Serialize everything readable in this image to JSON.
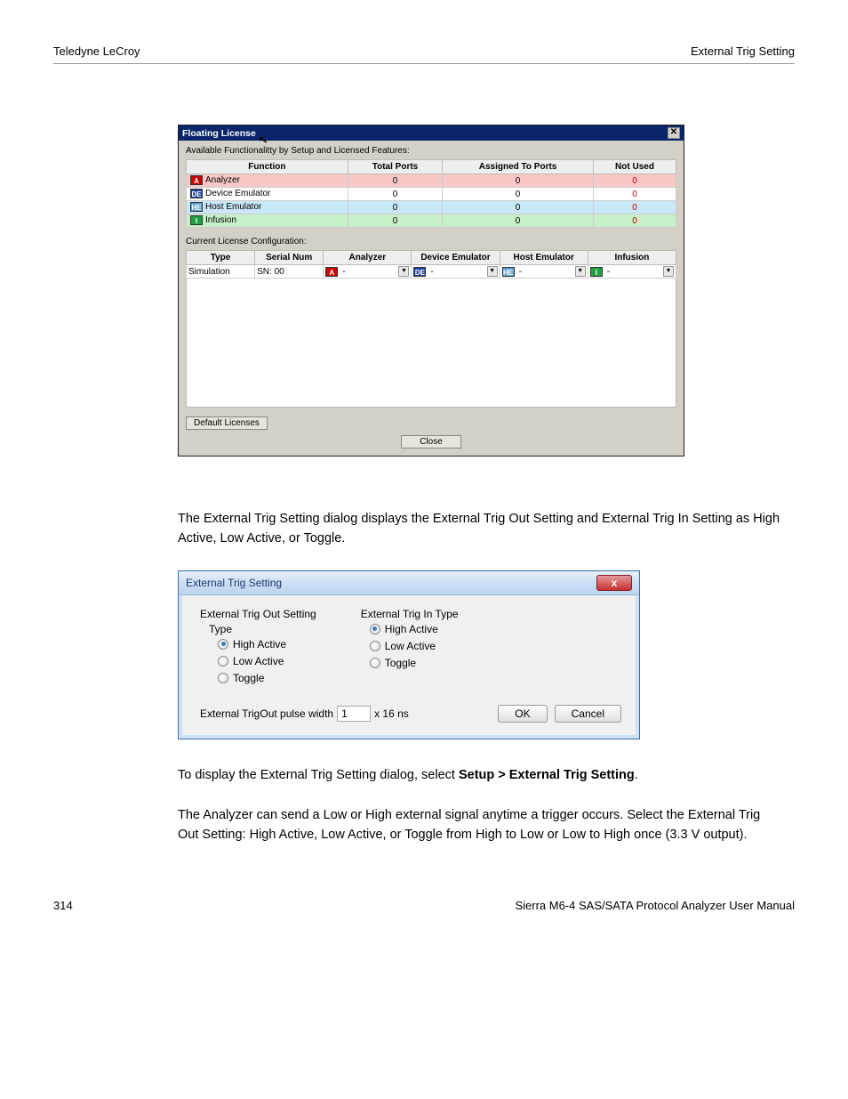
{
  "header": {
    "left": "Teledyne LeCroy",
    "right": "External Trig Setting"
  },
  "footer": {
    "left": "314",
    "right": "Sierra M6-4 SAS/SATA Protocol Analyzer User Manual"
  },
  "dlg1": {
    "title": "Floating License",
    "close_glyph": "✕",
    "cursor": "↖",
    "available_label": "Available Functionalitty by Setup and Licensed Features:",
    "func_headers": [
      "Function",
      "Total Ports",
      "Assigned To Ports",
      "Not Used"
    ],
    "func_rows": [
      {
        "icon": "A",
        "name": "Analyzer",
        "total": "0",
        "assigned": "0",
        "notused": "0"
      },
      {
        "icon": "DE",
        "name": "Device Emulator",
        "total": "0",
        "assigned": "0",
        "notused": "0"
      },
      {
        "icon": "HE",
        "name": "Host Emulator",
        "total": "0",
        "assigned": "0",
        "notused": "0"
      },
      {
        "icon": "I",
        "name": "Infusion",
        "total": "0",
        "assigned": "0",
        "notused": "0"
      }
    ],
    "current_label": "Current License Configuration:",
    "lic_headers": [
      "Type",
      "Serial Num",
      "Analyzer",
      "Device Emulator",
      "Host Emulator",
      "Infusion"
    ],
    "lic_row": {
      "type": "Simulation",
      "sn": "SN: 00",
      "dash": "-",
      "chev": "▼"
    },
    "default_btn": "Default Licenses",
    "close_btn": "Close"
  },
  "text1": "The External Trig Setting dialog displays the External Trig Out Setting and External Trig In Setting as High Active, Low Active, or Toggle.",
  "dlg2": {
    "title": "External Trig Setting",
    "close_glyph": "x",
    "out_group": "External Trig Out Setting",
    "type_label": "Type",
    "opt_high": "High Active",
    "opt_low": "Low Active",
    "opt_toggle": "Toggle",
    "in_group": "External Trig In Type",
    "pulse_label": "External TrigOut pulse width",
    "pulse_value": "1",
    "pulse_unit": "x 16 ns",
    "ok": "OK",
    "cancel": "Cancel"
  },
  "text2_a": "To display the External Trig Setting dialog, select ",
  "text2_b": "Setup > External Trig Setting",
  "text2_c": ".",
  "text3": "The Analyzer can send a Low or High external signal anytime a trigger occurs. Select the External Trig Out Setting: High Active, Low Active, or Toggle from High to Low or Low to High once (3.3 V output)."
}
